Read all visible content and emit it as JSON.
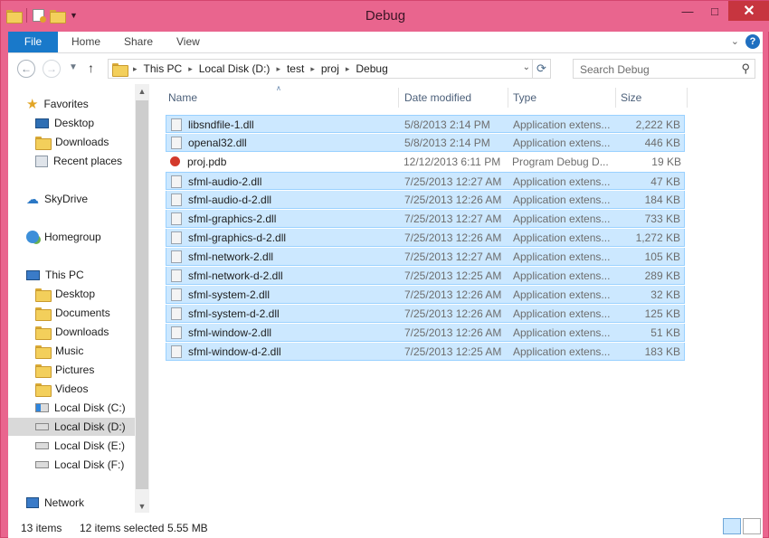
{
  "window": {
    "title": "Debug"
  },
  "ribbon": {
    "tabs": [
      "File",
      "Home",
      "Share",
      "View"
    ],
    "help_label": "?"
  },
  "address": {
    "crumbs": [
      "This PC",
      "Local Disk (D:)",
      "test",
      "proj",
      "Debug"
    ]
  },
  "search": {
    "placeholder": "Search Debug"
  },
  "nav": {
    "favorites_header": "Favorites",
    "favorites": [
      "Desktop",
      "Downloads",
      "Recent places"
    ],
    "skydrive": "SkyDrive",
    "homegroup": "Homegroup",
    "thispc_header": "This PC",
    "thispc": [
      "Desktop",
      "Documents",
      "Downloads",
      "Music",
      "Pictures",
      "Videos",
      "Local Disk (C:)",
      "Local Disk (D:)",
      "Local Disk (E:)",
      "Local Disk (F:)"
    ],
    "network": "Network"
  },
  "columns": {
    "name": "Name",
    "date": "Date modified",
    "type": "Type",
    "size": "Size"
  },
  "files": [
    {
      "name": "libsndfile-1.dll",
      "date": "5/8/2013 2:14 PM",
      "type": "Application extens...",
      "size": "2,222 KB"
    },
    {
      "name": "openal32.dll",
      "date": "5/8/2013 2:14 PM",
      "type": "Application extens...",
      "size": "446 KB"
    },
    {
      "name": "proj.pdb",
      "date": "12/12/2013 6:11 PM",
      "type": "Program Debug D...",
      "size": "19 KB"
    },
    {
      "name": "sfml-audio-2.dll",
      "date": "7/25/2013 12:27 AM",
      "type": "Application extens...",
      "size": "47 KB"
    },
    {
      "name": "sfml-audio-d-2.dll",
      "date": "7/25/2013 12:26 AM",
      "type": "Application extens...",
      "size": "184 KB"
    },
    {
      "name": "sfml-graphics-2.dll",
      "date": "7/25/2013 12:27 AM",
      "type": "Application extens...",
      "size": "733 KB"
    },
    {
      "name": "sfml-graphics-d-2.dll",
      "date": "7/25/2013 12:26 AM",
      "type": "Application extens...",
      "size": "1,272 KB"
    },
    {
      "name": "sfml-network-2.dll",
      "date": "7/25/2013 12:27 AM",
      "type": "Application extens...",
      "size": "105 KB"
    },
    {
      "name": "sfml-network-d-2.dll",
      "date": "7/25/2013 12:25 AM",
      "type": "Application extens...",
      "size": "289 KB"
    },
    {
      "name": "sfml-system-2.dll",
      "date": "7/25/2013 12:26 AM",
      "type": "Application extens...",
      "size": "32 KB"
    },
    {
      "name": "sfml-system-d-2.dll",
      "date": "7/25/2013 12:26 AM",
      "type": "Application extens...",
      "size": "125 KB"
    },
    {
      "name": "sfml-window-2.dll",
      "date": "7/25/2013 12:26 AM",
      "type": "Application extens...",
      "size": "51 KB"
    },
    {
      "name": "sfml-window-d-2.dll",
      "date": "7/25/2013 12:25 AM",
      "type": "Application extens...",
      "size": "183 KB"
    }
  ],
  "status": {
    "count": "13 items",
    "selected": "12 items selected",
    "size": "5.55 MB"
  }
}
